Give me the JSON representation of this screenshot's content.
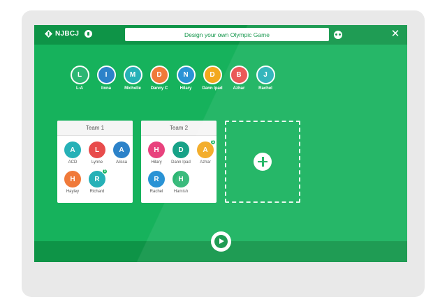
{
  "header": {
    "brand": "NJBCJ",
    "title": "Design your own Olympic Game",
    "close_label": "✕"
  },
  "pool": [
    {
      "initial": "L",
      "name": "L-A",
      "color": "#2cb673"
    },
    {
      "initial": "I",
      "name": "Ilona",
      "color": "#2c82c9"
    },
    {
      "initial": "M",
      "name": "Michelle",
      "color": "#26b1b7"
    },
    {
      "initial": "D",
      "name": "Danny C",
      "color": "#f07a3a"
    },
    {
      "initial": "N",
      "name": "Hilary",
      "color": "#2a93d5"
    },
    {
      "initial": "D",
      "name": "Dann Ipad",
      "color": "#f2a81d"
    },
    {
      "initial": "B",
      "name": "Azhar",
      "color": "#e84c4c"
    },
    {
      "initial": "J",
      "name": "Rachel",
      "color": "#26b1b7"
    }
  ],
  "teams": [
    {
      "title": "Team 1",
      "members": [
        {
          "initial": "A",
          "name": "ACD",
          "color": "#26b1b7",
          "badge": ""
        },
        {
          "initial": "L",
          "name": "Lynne",
          "color": "#e84c4c",
          "badge": ""
        },
        {
          "initial": "A",
          "name": "Alissa",
          "color": "#2c82c9",
          "badge": ""
        },
        {
          "initial": "H",
          "name": "Hayley",
          "color": "#f07a3a",
          "badge": ""
        },
        {
          "initial": "R",
          "name": "Richard",
          "color": "#26b1b7",
          "badge": "1"
        }
      ]
    },
    {
      "title": "Team 2",
      "members": [
        {
          "initial": "H",
          "name": "Hilary",
          "color": "#e8427d",
          "badge": ""
        },
        {
          "initial": "D",
          "name": "Dann Ipad",
          "color": "#17a287",
          "badge": ""
        },
        {
          "initial": "A",
          "name": "Azhar",
          "color": "#f2a81d",
          "badge": "1"
        },
        {
          "initial": "R",
          "name": "Rachel",
          "color": "#2a93d5",
          "badge": ""
        },
        {
          "initial": "H",
          "name": "Hamish",
          "color": "#2cb673",
          "badge": ""
        }
      ]
    }
  ],
  "colors": {
    "screen": "#16b25c",
    "bar": "#0e9447"
  }
}
